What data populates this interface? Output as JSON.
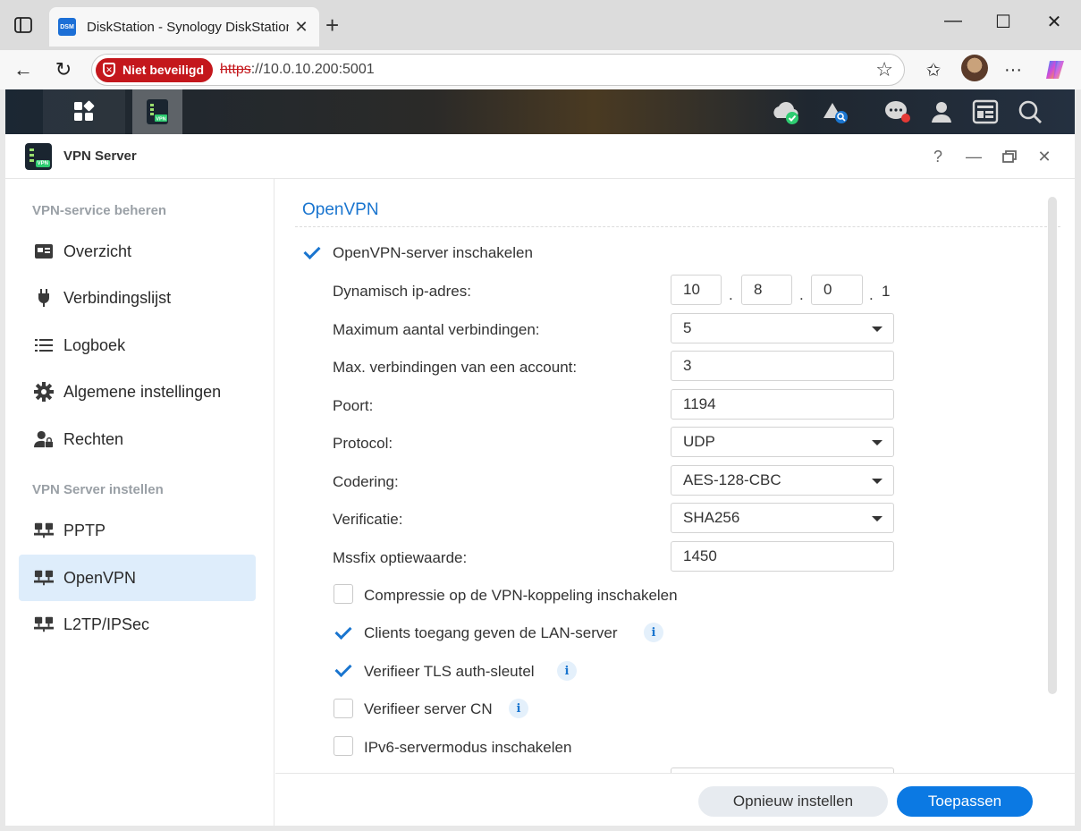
{
  "browser": {
    "tab_title": "DiskStation - Synology DiskStation",
    "tab_favicon": "DSM",
    "security_label": "Niet beveiligd",
    "url_scheme": "https",
    "url_rest": "://10.0.10.200:5001"
  },
  "window": {
    "title": "VPN Server",
    "app_badge": "VPN"
  },
  "sidebar": {
    "section1": "VPN-service beheren",
    "items1": [
      {
        "label": "Overzicht",
        "icon": "overview-icon"
      },
      {
        "label": "Verbindingslijst",
        "icon": "plug-icon"
      },
      {
        "label": "Logboek",
        "icon": "list-icon"
      },
      {
        "label": "Algemene instellingen",
        "icon": "gear-icon"
      },
      {
        "label": "Rechten",
        "icon": "user-lock-icon"
      }
    ],
    "section2": "VPN Server instellen",
    "items2": [
      {
        "label": "PPTP",
        "icon": "network-icon"
      },
      {
        "label": "OpenVPN",
        "icon": "network-icon",
        "active": true
      },
      {
        "label": "L2TP/IPSec",
        "icon": "network-icon"
      }
    ]
  },
  "form": {
    "section_title": "OpenVPN",
    "enable_label": "OpenVPN-server inschakelen",
    "enable_checked": true,
    "dynamic_ip_label": "Dynamisch ip-adres:",
    "ip": [
      "10",
      "8",
      "0",
      "1"
    ],
    "max_conn_label": "Maximum aantal verbindingen:",
    "max_conn_value": "5",
    "max_acc_label": "Max. verbindingen van een account:",
    "max_acc_value": "3",
    "port_label": "Poort:",
    "port_value": "1194",
    "protocol_label": "Protocol:",
    "protocol_value": "UDP",
    "encryption_label": "Codering:",
    "encryption_value": "AES-128-CBC",
    "auth_label": "Verificatie:",
    "auth_value": "SHA256",
    "mssfix_label": "Mssfix optiewaarde:",
    "mssfix_value": "1450",
    "options": [
      {
        "label": "Compressie op de VPN-koppeling inschakelen",
        "checked": false,
        "info": false
      },
      {
        "label": "Clients toegang geven de LAN-server",
        "checked": true,
        "info": true
      },
      {
        "label": "Verifieer TLS auth-sleutel",
        "checked": true,
        "info": true
      },
      {
        "label": "Verifieer server CN",
        "checked": false,
        "info": true
      },
      {
        "label": "IPv6-servermodus inschakelen",
        "checked": false,
        "info": false
      }
    ]
  },
  "footer": {
    "reset_label": "Opnieuw instellen",
    "apply_label": "Toepassen"
  },
  "colors": {
    "accent": "#1a75cf",
    "apply": "#0b79e3",
    "insecure": "#c4171c",
    "active_nav": "#deedfb"
  }
}
